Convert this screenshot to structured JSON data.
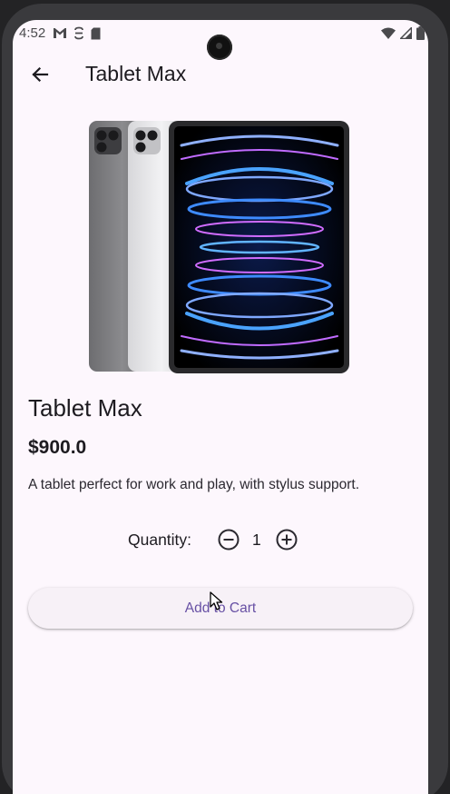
{
  "status_bar": {
    "time": "4:52",
    "left_icons": [
      "gmail-icon",
      "sync-icon",
      "sd-card-icon"
    ],
    "right_icons": [
      "wifi-icon",
      "signal-icon",
      "battery-icon"
    ]
  },
  "app_bar": {
    "title": "Tablet Max",
    "back_icon": "arrow-back-icon"
  },
  "product": {
    "image_alt": "tablet-product-image",
    "name": "Tablet Max",
    "price": "$900.0",
    "description": "A tablet perfect for work and play, with stylus support."
  },
  "quantity": {
    "label": "Quantity:",
    "value": "1",
    "minus_icon": "remove-circle-icon",
    "plus_icon": "add-circle-icon"
  },
  "actions": {
    "add_to_cart_label": "Add to Cart"
  },
  "colors": {
    "background": "#fdf7fd",
    "accent": "#6750a4",
    "text": "#1d1b20"
  }
}
